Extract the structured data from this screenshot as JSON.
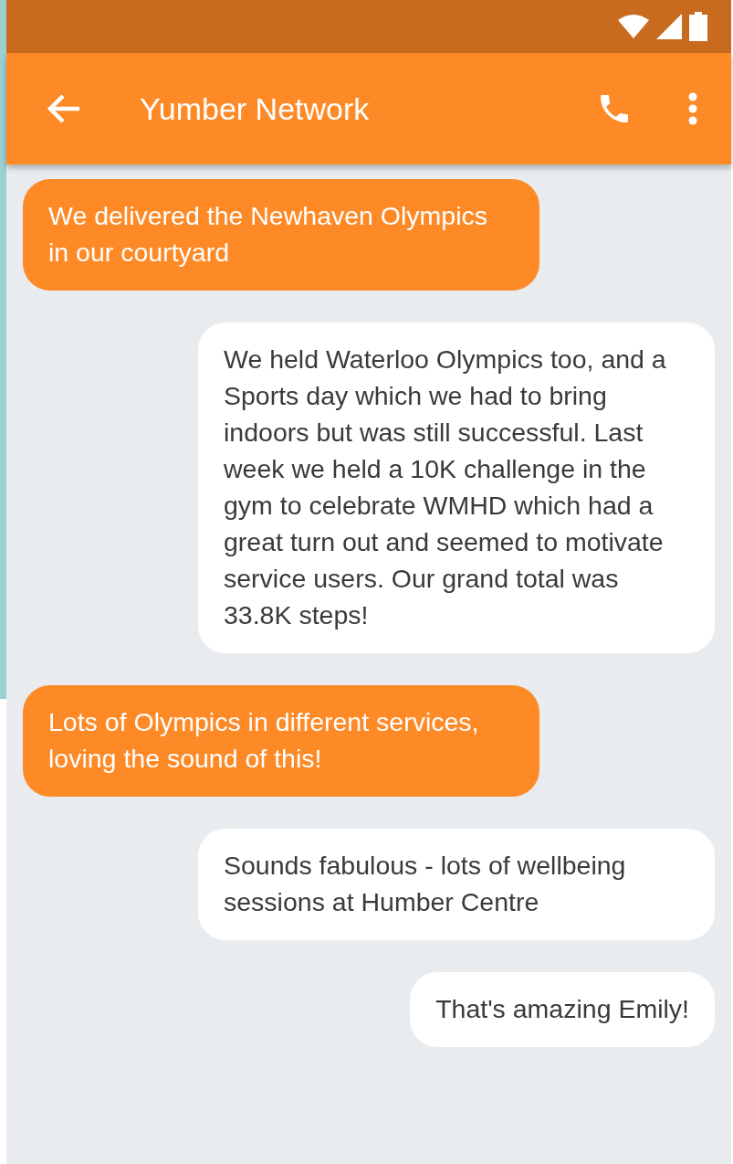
{
  "app_bar": {
    "title": "Yumber Network"
  },
  "messages": [
    {
      "kind": "incoming",
      "text": "We delivered the Newhaven Olympics in our courtyard"
    },
    {
      "kind": "outgoing",
      "text": "We held Waterloo Olympics too, and a Sports day which we had to bring indoors but was still successful. Last week we held a 10K challenge in the gym to celebrate WMHD which had a great turn out and seemed to motivate service users. Our grand total was 33.8K steps!"
    },
    {
      "kind": "incoming",
      "text": "Lots of Olympics in different services, loving the sound of this!"
    },
    {
      "kind": "outgoing",
      "text": "Sounds fabulous - lots of wellbeing sessions at Humber Centre"
    },
    {
      "kind": "outgoing",
      "text": "That's amazing Emily!"
    }
  ]
}
